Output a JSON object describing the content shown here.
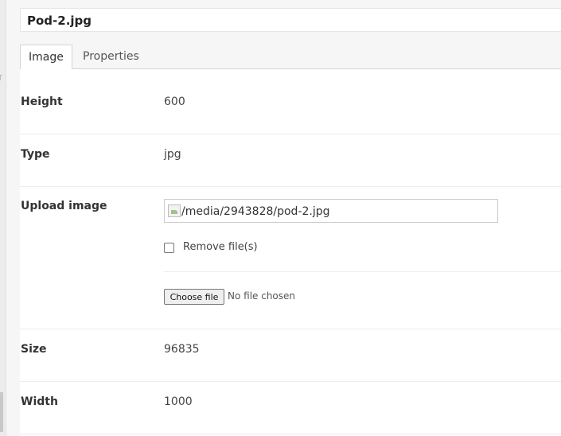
{
  "title": "Pod-2.jpg",
  "tabs": [
    {
      "label": "Image",
      "active": true
    },
    {
      "label": "Properties",
      "active": false
    }
  ],
  "fields": {
    "height": {
      "label": "Height",
      "value": "600"
    },
    "type": {
      "label": "Type",
      "value": "jpg"
    },
    "upload": {
      "label": "Upload image",
      "current_url": "/media/2943828/pod-2.jpg",
      "remove_label": "Remove file(s)",
      "remove_checked": false,
      "choose_button": "Choose file",
      "no_file_text": "No file chosen"
    },
    "size": {
      "label": "Size",
      "value": "96835"
    },
    "width": {
      "label": "Width",
      "value": "1000"
    }
  },
  "icons": {
    "broken_image": "broken-image-icon"
  }
}
